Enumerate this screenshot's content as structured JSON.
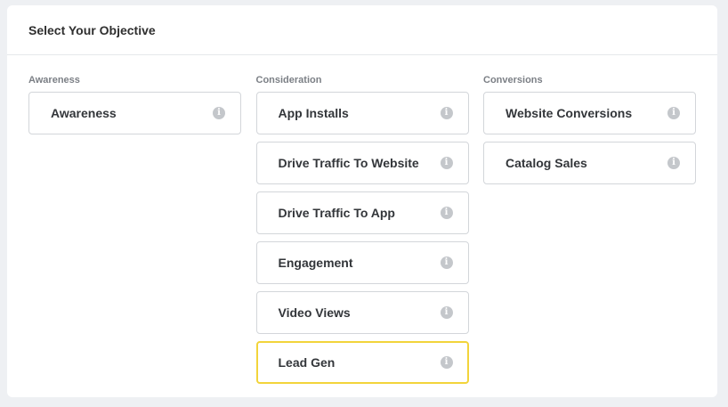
{
  "header": {
    "title": "Select Your Objective"
  },
  "columns": [
    {
      "label": "Awareness",
      "options": [
        {
          "label": "Awareness",
          "info": "i"
        }
      ]
    },
    {
      "label": "Consideration",
      "options": [
        {
          "label": "App Installs",
          "info": "i"
        },
        {
          "label": "Drive Traffic To Website",
          "info": "i"
        },
        {
          "label": "Drive Traffic To App",
          "info": "i"
        },
        {
          "label": "Engagement",
          "info": "i"
        },
        {
          "label": "Video Views",
          "info": "i"
        },
        {
          "label": "Lead Gen",
          "info": "i",
          "selected": true
        }
      ]
    },
    {
      "label": "Conversions",
      "options": [
        {
          "label": "Website Conversions",
          "info": "i"
        },
        {
          "label": "Catalog Sales",
          "info": "i"
        }
      ]
    }
  ],
  "colors": {
    "selected_border": "#f2d43b",
    "option_border": "#d3d6da",
    "info_icon": "#c4c7cb"
  }
}
